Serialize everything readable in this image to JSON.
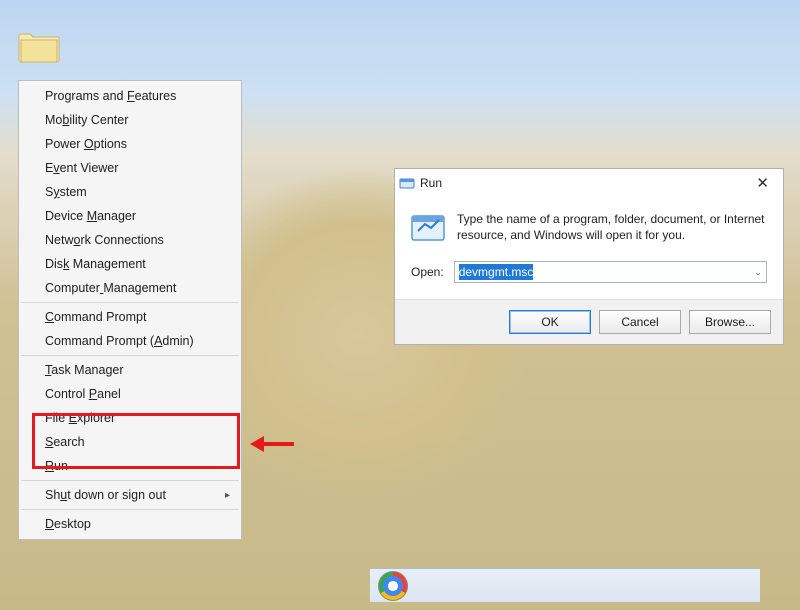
{
  "winx": {
    "items": [
      {
        "label": "Programs and Features",
        "underline_index": 13
      },
      {
        "label": "Mobility Center",
        "underline_index": 2
      },
      {
        "label": "Power Options",
        "underline_index": 6
      },
      {
        "label": "Event Viewer",
        "underline_index": 1
      },
      {
        "label": "System",
        "underline_index": 1
      },
      {
        "label": "Device Manager",
        "underline_index": 7
      },
      {
        "label": "Network Connections",
        "underline_index": 4
      },
      {
        "label": "Disk Management",
        "underline_index": 3
      },
      {
        "label": "Computer Management",
        "underline_index": 8
      },
      {
        "label": "Command Prompt",
        "underline_index": 0,
        "highlight": true
      },
      {
        "label": "Command Prompt (Admin)",
        "underline_index": 16,
        "highlight": true
      },
      {
        "label": "Task Manager",
        "underline_index": 0
      },
      {
        "label": "Control Panel",
        "underline_index": 8
      },
      {
        "label": "File Explorer",
        "underline_index": 5
      },
      {
        "label": "Search",
        "underline_index": 0
      },
      {
        "label": "Run",
        "underline_index": 0
      },
      {
        "label": "Shut down or sign out",
        "underline_index": 2,
        "submenu": true
      },
      {
        "label": "Desktop",
        "underline_index": 0
      }
    ],
    "separators_after": [
      8,
      10,
      15,
      16
    ]
  },
  "run": {
    "title": "Run",
    "description": "Type the name of a program, folder, document, or Internet resource, and Windows will open it for you.",
    "open_label": "Open:",
    "value": "devmgmt.msc",
    "buttons": {
      "ok": "OK",
      "cancel": "Cancel",
      "browse": "Browse..."
    }
  }
}
